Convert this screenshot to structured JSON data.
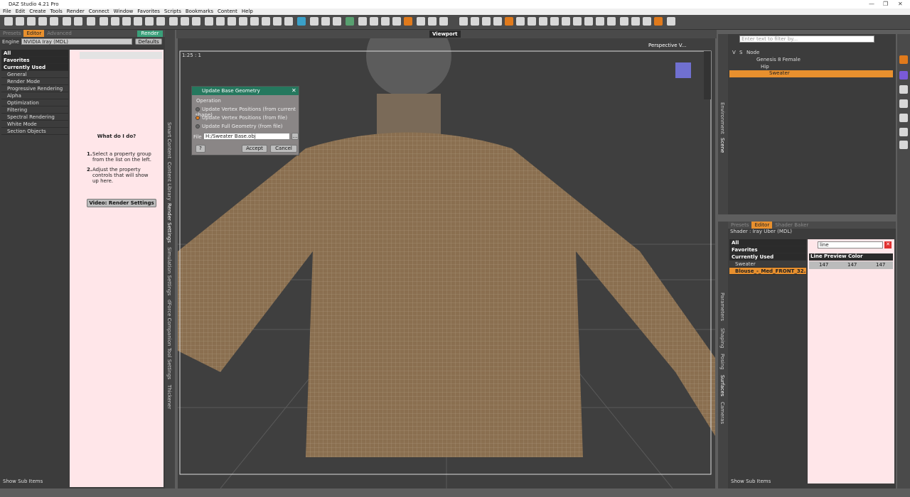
{
  "app": {
    "title": "DAZ Studio 4.21 Pro",
    "win_controls": [
      "—",
      "❐",
      "✕"
    ]
  },
  "menu": [
    "File",
    "Edit",
    "Create",
    "Tools",
    "Render",
    "Connect",
    "Window",
    "Favorites",
    "Scripts",
    "Bookmarks",
    "Content",
    "Help"
  ],
  "left": {
    "tabs": [
      "Presets",
      "Editor",
      "Advanced"
    ],
    "render_btn": "Render",
    "engine_label": "Engine",
    "engine_value": "NVIDIA Iray (MDL)",
    "defaults": "Defaults",
    "groups": [
      "All",
      "Favorites",
      "Currently Used"
    ],
    "items": [
      "General",
      "Render Mode",
      "Progressive Rendering",
      "Alpha",
      "Optimization",
      "Filtering",
      "Spectral Rendering",
      "White Mode",
      "Section Objects"
    ],
    "help_title": "What do I do?",
    "help1": "Select a property group from the list on the left.",
    "help2": "Adjust the property controls that will show up here.",
    "help1_num": "1.",
    "help2_num": "2.",
    "video_btn": "Video: Render Settings",
    "show_sub": "Show Sub Items",
    "vtabs": [
      "Smart Content",
      "Content Library",
      "Render Settings",
      "Simulation Settings",
      "dForce Companion",
      "Tool Settings",
      "Thickener"
    ]
  },
  "viewport": {
    "title": "Viewport",
    "scale": "1:25 : 1",
    "camera": "Perspective V..."
  },
  "dialog": {
    "title": "Update Base Geometry",
    "operation": "Operation",
    "opt1": "Update Vertex Positions (from current shape)",
    "opt2": "Update Vertex Positions (from file)",
    "opt3": "Update Full Geometry (from file)",
    "file_label": "File",
    "file_value": "H:/Sweater Base.obj",
    "help": "?",
    "accept": "Accept",
    "cancel": "Cancel"
  },
  "scene": {
    "filter_placeholder": "Enter text to filter by...",
    "col_v": "V",
    "col_s": "S",
    "col_node": "Node",
    "nodes": [
      "Genesis 8 Female",
      "Hip",
      "Sweater"
    ],
    "vtabs": [
      "Environment",
      "Scene"
    ]
  },
  "surfaces": {
    "tabs": [
      "Presets",
      "Editor",
      "Shader Baker"
    ],
    "shader": "Shader : Iray Uber (MDL)",
    "groups": [
      "All",
      "Favorites",
      "Currently Used"
    ],
    "tree_root": "Sweater",
    "tree_item": "Blouse_-_Med_FRONT_32...",
    "search": "line",
    "prop_name": "Line Preview Color",
    "r": "147",
    "g": "147",
    "b": "147",
    "show_sub": "Show Sub Items",
    "vtabs": [
      "Parameters",
      "Shaping",
      "Posing",
      "Surfaces",
      "Cameras"
    ]
  },
  "colors": {
    "accent": "#e8902e",
    "dialog_title": "#25785e"
  }
}
